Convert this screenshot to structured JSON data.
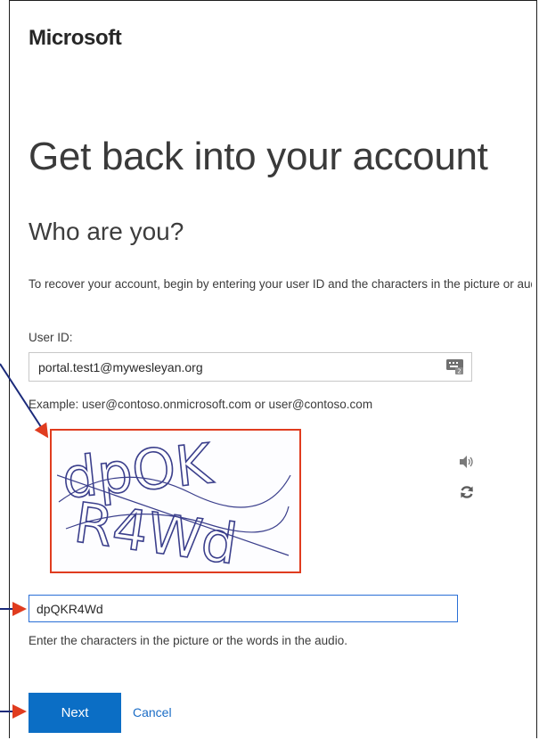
{
  "brand": {
    "name": "Microsoft"
  },
  "page": {
    "title": "Get back into your account",
    "subtitle": "Who are you?",
    "intro": "To recover your account, begin by entering your user ID and the characters in the picture or audio below."
  },
  "form": {
    "userid_label": "User ID:",
    "userid_value": "portal.test1@mywesleyan.org",
    "userid_example": "Example: user@contoso.onmicrosoft.com or user@contoso.com",
    "captcha_value": "dpQKR4Wd",
    "captcha_help": "Enter the characters in the picture or the words in the audio.",
    "captcha_image_text": "dpQK R4Wd"
  },
  "actions": {
    "next_label": "Next",
    "cancel_label": "Cancel"
  },
  "colors": {
    "accent": "#0b6ec5",
    "link": "#1a6cc6",
    "annotation": "#e03c1f",
    "focus": "#2a6fd6"
  },
  "icons": {
    "userid_field": "keyboard-icon",
    "audio": "speaker-icon",
    "refresh": "refresh-icon"
  }
}
